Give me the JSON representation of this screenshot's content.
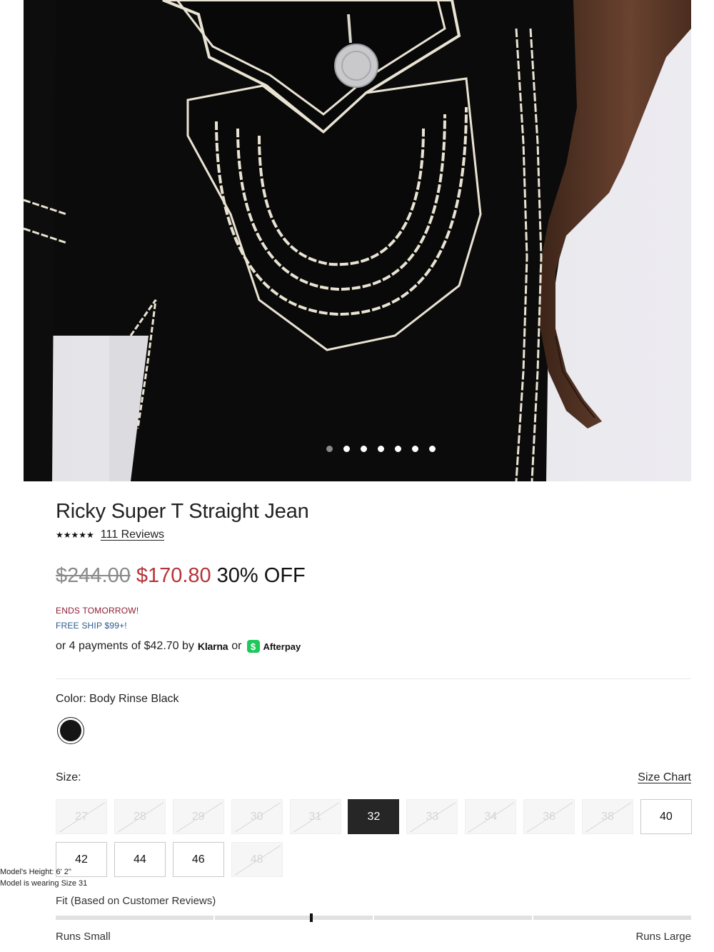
{
  "hero": {
    "image": "product-photo-back-pocket",
    "carousel_count": 7,
    "active_index": 0
  },
  "product": {
    "title": "Ricky Super T Straight Jean",
    "stars": "★★★★★",
    "reviews_label": "111 Reviews",
    "price_original": "$244.00",
    "price_sale": "$170.80",
    "discount": "30% OFF",
    "promo_ends": "ENDS TOMORROW!",
    "promo_ship": "FREE SHIP $99+!",
    "payments": {
      "prefix": "or 4 payments of $42.70 by",
      "klarna": "Klarna",
      "or": "or",
      "afterpay_icon": "$",
      "afterpay": "Afterpay"
    }
  },
  "color": {
    "label": "Color: Body Rinse Black",
    "swatch_color": "#151515"
  },
  "size": {
    "label": "Size:",
    "chart_link": "Size Chart",
    "options": [
      {
        "label": "27",
        "available": false
      },
      {
        "label": "28",
        "available": false
      },
      {
        "label": "29",
        "available": false
      },
      {
        "label": "30",
        "available": false
      },
      {
        "label": "31",
        "available": false
      },
      {
        "label": "32",
        "available": true,
        "selected": true
      },
      {
        "label": "33",
        "available": false
      },
      {
        "label": "34",
        "available": false
      },
      {
        "label": "36",
        "available": false
      },
      {
        "label": "38",
        "available": false
      },
      {
        "label": "40",
        "available": true
      },
      {
        "label": "42",
        "available": true
      },
      {
        "label": "44",
        "available": true
      },
      {
        "label": "46",
        "available": true
      },
      {
        "label": "48",
        "available": false
      }
    ]
  },
  "model": {
    "height": "Model's Height: 6' 2\"",
    "wearing": "Model is wearing Size 31"
  },
  "fit": {
    "label": "Fit (Based on Customer Reviews)",
    "value_fraction": 0.4,
    "small_label": "Runs Small",
    "large_label": "Runs Large"
  },
  "colors": {
    "sale_red": "#b5343a",
    "promo_maroon": "#8b1e35",
    "promo_blue": "#2a5a8c",
    "afterpay_green": "#1ec85a"
  }
}
